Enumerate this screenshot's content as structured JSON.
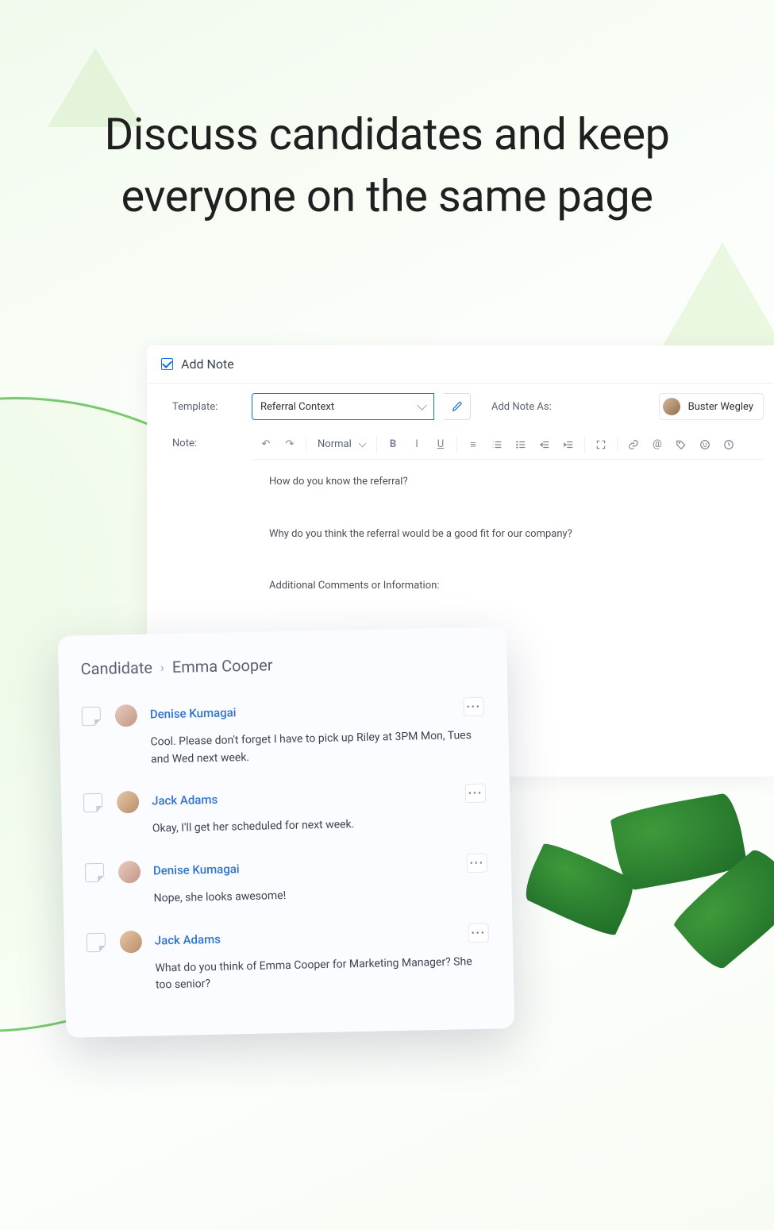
{
  "headline": "Discuss candidates and keep everyone on the same page",
  "addNote": {
    "title": "Add Note",
    "templateLabel": "Template:",
    "templateValue": "Referral Context",
    "noteLabel": "Note:",
    "addNoteAsLabel": "Add Note As:",
    "userName": "Buster Wegley",
    "formatSelect": "Normal",
    "prompts": {
      "q1": "How do you know the referral?",
      "q2": "Why do you think the referral would be a good fit for our company?",
      "q3": "Additional Comments or Information:"
    }
  },
  "notesCard": {
    "breadcrumbRoot": "Candidate",
    "breadcrumbName": "Emma Cooper",
    "items": [
      {
        "author": "Denise Kumagai",
        "body": "Cool.  Please don't forget I have to pick up Riley at 3PM Mon, Tues and Wed next week."
      },
      {
        "author": "Jack Adams",
        "body": "Okay, I'll get her scheduled for next week."
      },
      {
        "author": "Denise Kumagai",
        "body": "Nope, she looks awesome!"
      },
      {
        "author": "Jack Adams",
        "body": "What do you think of Emma Cooper for Marketing Manager?  She too senior?"
      }
    ]
  }
}
